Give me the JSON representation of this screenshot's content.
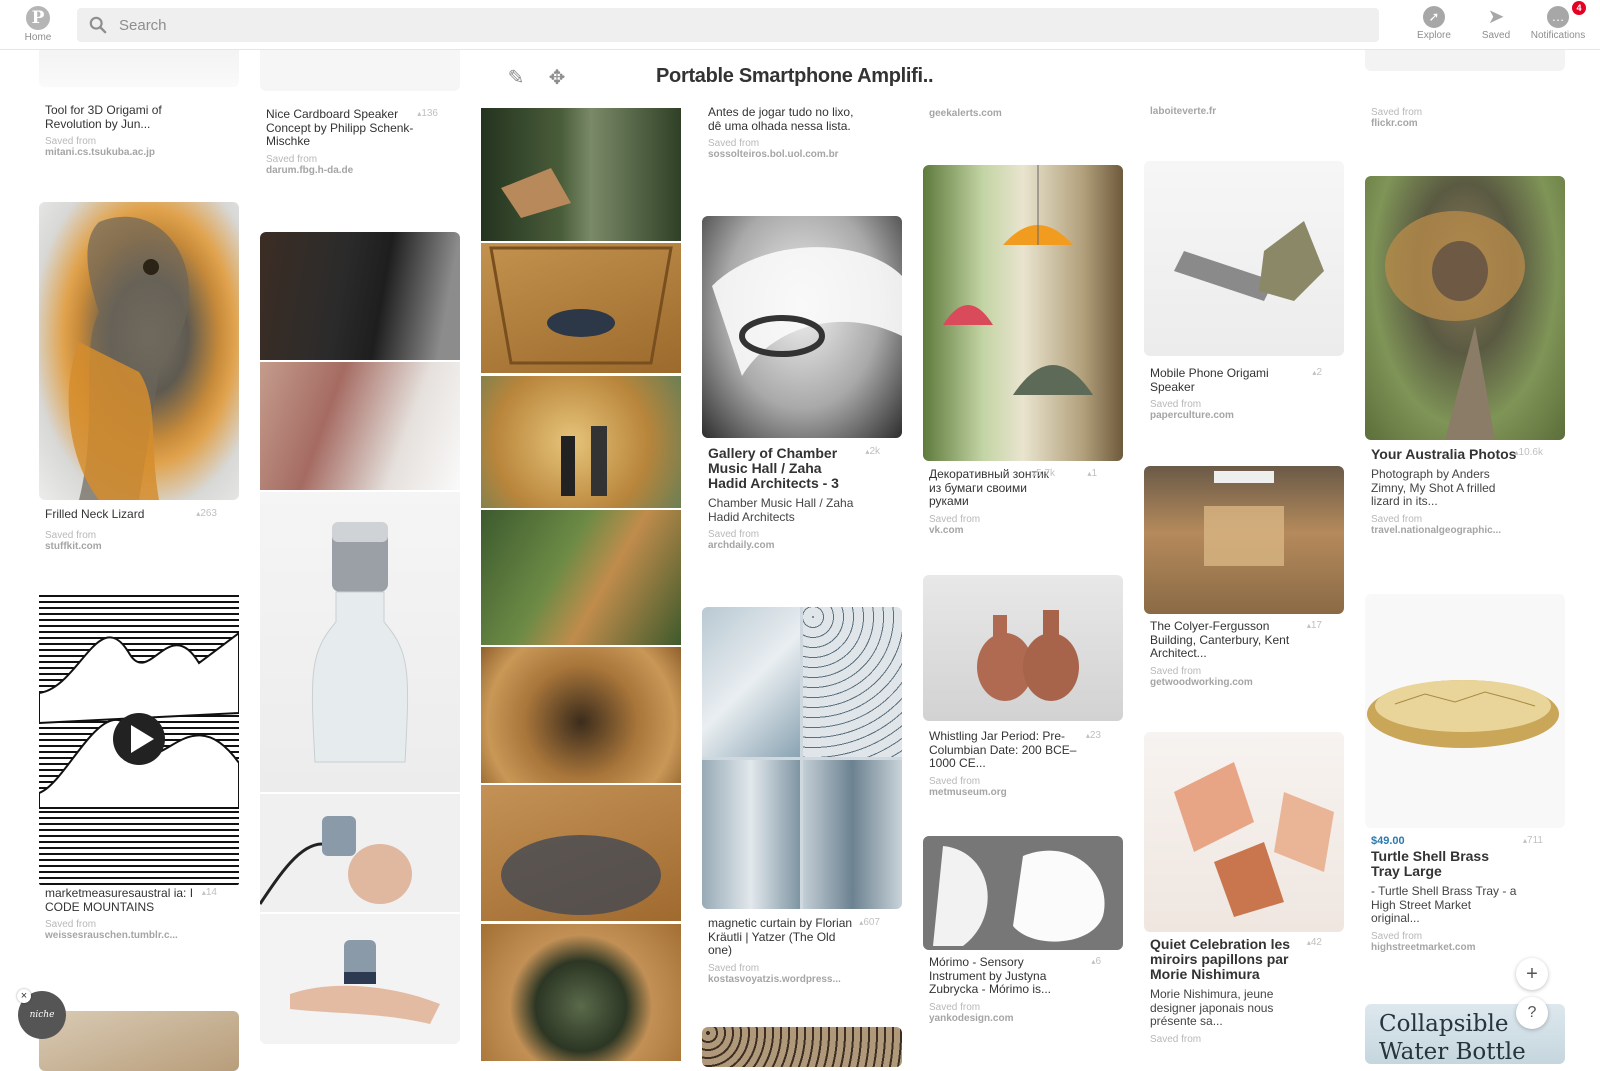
{
  "header": {
    "home_label": "Home",
    "search_placeholder": "Search",
    "explore_label": "Explore",
    "saved_label": "Saved",
    "notifications_label": "Notifications",
    "notifications_badge": "4"
  },
  "closeup": {
    "title": "Portable Smartphone Amplifi..",
    "edit_icon": "pencil-icon",
    "move_icon": "move-icon"
  },
  "col1": {
    "pin0": {
      "title": "Tool for 3D Origami of Revolution by Jun...",
      "saved_from": "Saved from",
      "source": "mitani.cs.tsukuba.ac.jp"
    },
    "pin1": {
      "title": "Frilled Neck Lizard",
      "count": "263",
      "saved_from": "Saved from",
      "source": "stuffkit.com"
    },
    "pin2": {
      "title": "marketmeasuresaustral ia: I CODE MOUNTAINS",
      "count": "14",
      "saved_from": "Saved from",
      "source": "weissesrauschen.tumblr.c..."
    }
  },
  "col2": {
    "pin0": {
      "title": "Nice Cardboard Speaker Concept by Philipp Schenk-Mischke",
      "count": "136",
      "saved_from": "Saved from",
      "source": "darum.fbg.h-da.de"
    }
  },
  "col4": {
    "pin0": {
      "title": "Antes de jogar tudo no lixo, dê uma olhada nessa lista.",
      "saved_from": "Saved from",
      "source": "sossolteiros.bol.uol.com.br"
    },
    "pin1": {
      "title": "Gallery of Chamber Music Hall / Zaha Hadid Architects - 3",
      "count": "2k",
      "desc": "Chamber Music Hall / Zaha Hadid Architects",
      "saved_from": "Saved from",
      "source": "archdaily.com"
    },
    "pin2": {
      "title": "magnetic curtain by Florian Kräutli | Yatzer (The Old one)",
      "count": "607",
      "saved_from": "Saved from",
      "source": "kostasvoyatzis.wordpress..."
    }
  },
  "col5": {
    "pin0": {
      "source": "geekalerts.com"
    },
    "pin1": {
      "title": "Декоративный зонтик из бумаги своими руками",
      "count": "5.7k",
      "count2": "1",
      "saved_from": "Saved from",
      "source": "vk.com"
    },
    "pin2": {
      "title": "Whistling Jar Period: Pre-Columbian Date: 200 BCE–1000 CE...",
      "count": "23",
      "saved_from": "Saved from",
      "source": "metmuseum.org"
    },
    "pin3": {
      "title": "Mórimo - Sensory Instrument by Justyna Zubrycka - Mórimo is...",
      "count": "6",
      "saved_from": "Saved from",
      "source": "yankodesign.com"
    }
  },
  "col6": {
    "pin0": {
      "source": "laboiteverte.fr"
    },
    "pin1": {
      "title": "Mobile Phone Origami Speaker",
      "count": "2",
      "saved_from": "Saved from",
      "source": "paperculture.com"
    },
    "pin2": {
      "title": "The Colyer-Fergusson Building, Canterbury, Kent Architect...",
      "count": "17",
      "saved_from": "Saved from",
      "source": "getwoodworking.com"
    },
    "pin3": {
      "title": "Quiet Celebration les miroirs papillons par Morie Nishimura",
      "count": "42",
      "desc": "Morie Nishimura, jeune designer japonais nous présente sa...",
      "saved_from": "Saved from"
    }
  },
  "col7": {
    "pin0": {
      "saved_from": "Saved from",
      "source": "flickr.com"
    },
    "pin1": {
      "title": "Your Australia Photos",
      "count": "10.6k",
      "desc": "Photograph by Anders Zimny, My Shot A frilled lizard in its...",
      "saved_from": "Saved from",
      "source": "travel.nationalgeographic..."
    },
    "pin2": {
      "price": "$49.00",
      "title": "Turtle Shell Brass Tray Large",
      "count": "711",
      "desc": "- Turtle Shell Brass Tray - a High Street Market original...",
      "saved_from": "Saved from",
      "source": "highstreetmarket.com"
    },
    "pin3": {
      "image_text": "Collapsible Water Bottle"
    }
  },
  "floating": {
    "add_label": "+",
    "help_label": "?",
    "niche_label": "niche",
    "close_label": "×"
  },
  "colors": {
    "brand_red": "#e60023",
    "header_icon_gray": "#a7a7a7",
    "link_blue": "#2a7ab0"
  }
}
